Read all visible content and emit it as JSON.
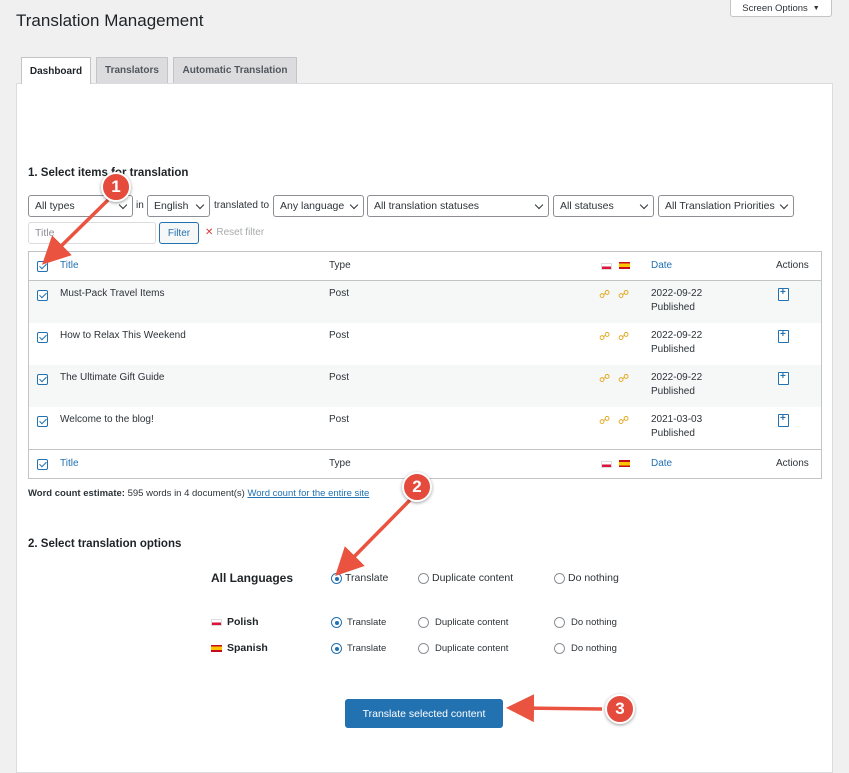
{
  "header": {
    "title": "Translation Management",
    "screen_options": "Screen Options"
  },
  "tabs": [
    {
      "label": "Dashboard",
      "active": true
    },
    {
      "label": "Translators",
      "active": false
    },
    {
      "label": "Automatic Translation",
      "active": false
    }
  ],
  "section1": {
    "heading": "1. Select items for translation",
    "filters": {
      "type": "All types",
      "in_label": "in",
      "source_language": "English",
      "translated_to_label": "translated to",
      "target_language": "Any language",
      "translation_status": "All translation statuses",
      "status": "All statuses",
      "priority": "All Translation Priorities",
      "title_placeholder": "Title",
      "filter_button": "Filter",
      "reset_filter": "Reset filter"
    },
    "table": {
      "columns": {
        "title": "Title",
        "type": "Type",
        "date": "Date",
        "actions": "Actions"
      },
      "rows": [
        {
          "title": "Must-Pack Travel Items",
          "type": "Post",
          "date": "2022-09-22",
          "status": "Published"
        },
        {
          "title": "How to Relax This Weekend",
          "type": "Post",
          "date": "2022-09-22",
          "status": "Published"
        },
        {
          "title": "The Ultimate Gift Guide",
          "type": "Post",
          "date": "2022-09-22",
          "status": "Published"
        },
        {
          "title": "Welcome to the blog!",
          "type": "Post",
          "date": "2021-03-03",
          "status": "Published"
        }
      ]
    },
    "word_count": {
      "label": "Word count estimate:",
      "text": "595 words in 4 document(s)",
      "link": "Word count for the entire site"
    }
  },
  "section2": {
    "heading": "2. Select translation options",
    "all_languages": "All Languages",
    "options": {
      "translate": "Translate",
      "duplicate": "Duplicate content",
      "nothing": "Do nothing"
    },
    "languages": [
      {
        "name": "Polish",
        "selected": "Translate"
      },
      {
        "name": "Spanish",
        "selected": "Translate"
      }
    ],
    "submit": "Translate selected content"
  },
  "annotations": [
    "1",
    "2",
    "3"
  ],
  "colors": {
    "accent": "#2271b1",
    "badge": "#e44b3c",
    "arrow": "#e9533f",
    "translation_icon": "#e0a10a"
  },
  "icons": {
    "translation_status": "translation-needed-icon",
    "action": "add-translation-icon"
  }
}
